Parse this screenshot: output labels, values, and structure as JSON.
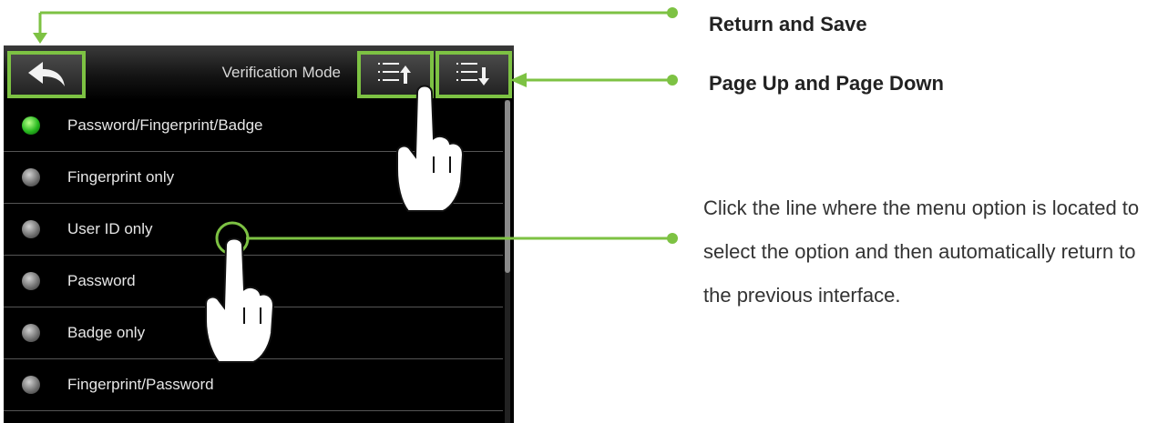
{
  "device": {
    "title": "Verification Mode",
    "buttons": {
      "back_icon": "return-arrow-icon",
      "page_up_icon": "page-up-icon",
      "page_down_icon": "page-down-icon"
    },
    "options": [
      {
        "label": "Password/Fingerprint/Badge",
        "selected": true
      },
      {
        "label": "Fingerprint only",
        "selected": false
      },
      {
        "label": "User ID only",
        "selected": false
      },
      {
        "label": "Password",
        "selected": false
      },
      {
        "label": "Badge only",
        "selected": false
      },
      {
        "label": "Fingerprint/Password",
        "selected": false
      }
    ]
  },
  "annotations": {
    "return_save": "Return and Save",
    "page_up_down": "Page Up and Page Down",
    "description": "Click the line where the menu option is located to select the option and then automatically return to the previous interface."
  },
  "colors": {
    "accent": "#7dc243",
    "selected_radio": "#26b81e"
  }
}
